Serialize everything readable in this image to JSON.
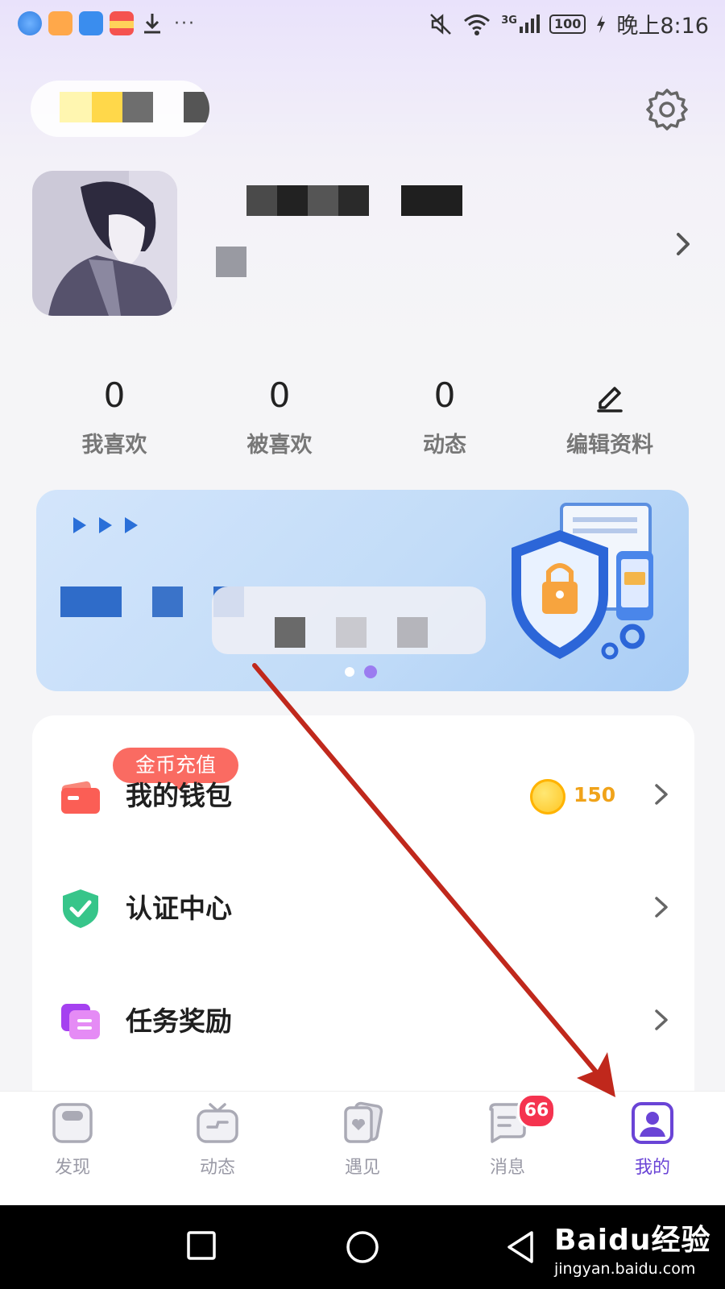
{
  "status_bar": {
    "time": "晚上8:16",
    "battery": "100",
    "network": "3G",
    "more": "···"
  },
  "profile": {
    "settings_icon": "gear-icon"
  },
  "stats": [
    {
      "value": "0",
      "label": "我喜欢"
    },
    {
      "value": "0",
      "label": "被喜欢"
    },
    {
      "value": "0",
      "label": "动态"
    },
    {
      "value": "",
      "label": "编辑资料",
      "icon": "edit-icon"
    }
  ],
  "banner": {
    "active_slide": 2,
    "slide_count": 2
  },
  "menu": {
    "wallet": {
      "label": "我的钱包",
      "tag": "金币充值",
      "coins": "150"
    },
    "verify": {
      "label": "认证中心"
    },
    "tasks": {
      "label": "任务奖励"
    }
  },
  "tabs": [
    {
      "label": "发现",
      "icon": "discover-icon"
    },
    {
      "label": "动态",
      "icon": "tv-icon"
    },
    {
      "label": "遇见",
      "icon": "cards-icon"
    },
    {
      "label": "消息",
      "icon": "message-icon",
      "badge": "66"
    },
    {
      "label": "我的",
      "icon": "profile-icon",
      "active": true
    }
  ],
  "watermark": {
    "main": "Baidu经验",
    "sub": "jingyan.baidu.com"
  },
  "colors": {
    "accent": "#6a44d6",
    "tag": "#fa6b62",
    "badge": "#f5334f",
    "coin": "#f0a31a",
    "arrow": "#c0281c"
  }
}
